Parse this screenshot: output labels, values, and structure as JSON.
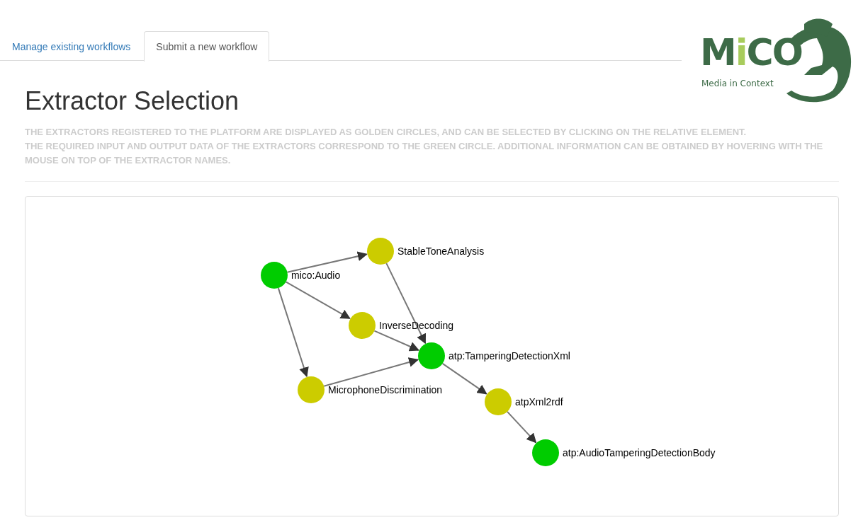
{
  "tabs": [
    {
      "label": "Manage existing workflows",
      "selected": false
    },
    {
      "label": "Submit a new workflow",
      "selected": true
    }
  ],
  "logo": {
    "wordmark": "MiCO",
    "tagline": "Media in Context"
  },
  "heading": "Extractor Selection",
  "description": [
    "THE EXTRACTORS REGISTERED TO THE PLATFORM ARE DISPLAYED AS GOLDEN CIRCLES, AND CAN BE SELECTED BY CLICKING ON THE RELATIVE ELEMENT.",
    "THE REQUIRED INPUT AND OUTPUT DATA OF THE EXTRACTORS CORRESPOND TO THE GREEN CIRCLE. ADDITIONAL INFORMATION CAN BE OBTAINED BY HOVERING WITH THE MOUSE ON TOP OF THE EXTRACTOR NAMES."
  ],
  "graph": {
    "nodes": [
      {
        "label": "mico:Audio",
        "kind": "data"
      },
      {
        "label": "StableToneAnalysis",
        "kind": "extractor"
      },
      {
        "label": "InverseDecoding",
        "kind": "extractor"
      },
      {
        "label": "atp:TamperingDetectionXml",
        "kind": "data"
      },
      {
        "label": "MicrophoneDiscrimination",
        "kind": "extractor"
      },
      {
        "label": "atpXml2rdf",
        "kind": "extractor"
      },
      {
        "label": "atp:AudioTamperingDetectionBody",
        "kind": "data"
      }
    ]
  }
}
